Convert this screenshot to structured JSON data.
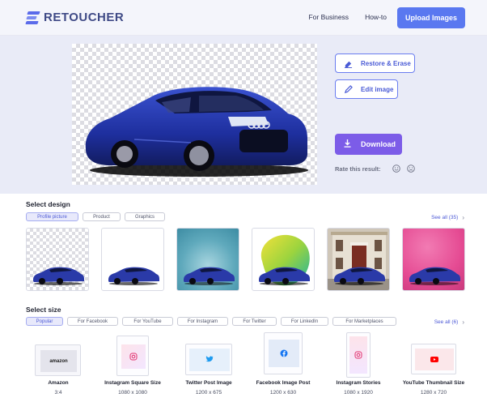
{
  "header": {
    "logo_text": "RETOUCHER",
    "nav": [
      "For Business",
      "How-to"
    ],
    "upload_label": "Upload Images"
  },
  "hero": {
    "restore_label": "Restore & Erase",
    "edit_label": "Edit image",
    "download_label": "Download",
    "rate_label": "Rate this result:"
  },
  "design": {
    "title": "Select design",
    "chips": [
      "Profile picture",
      "Product",
      "Graphics"
    ],
    "see_all": "See all (35)",
    "thumbs": [
      "transparent",
      "white",
      "teal",
      "blob",
      "house",
      "pink"
    ]
  },
  "size": {
    "title": "Select size",
    "chips": [
      "Popular",
      "For Facebook",
      "For YouTube",
      "For Instagram",
      "For Twitter",
      "For LinkedIn",
      "For Marketplaces"
    ],
    "see_all": "See all (6)",
    "items": [
      {
        "name": "Amazon",
        "dims": "3:4",
        "icon": "amazon-logo"
      },
      {
        "name": "Instagram Square Size",
        "dims": "1080 x 1080",
        "icon": "instagram-icon"
      },
      {
        "name": "Twitter Post Image",
        "dims": "1200 x 675",
        "icon": "twitter-icon"
      },
      {
        "name": "Facebook Image Post",
        "dims": "1200 x 630",
        "icon": "facebook-icon"
      },
      {
        "name": "Instagram Stories",
        "dims": "1080 x 1920",
        "icon": "instagram-icon"
      },
      {
        "name": "YouTube Thumbnail Size",
        "dims": "1280 x 720",
        "icon": "youtube-icon"
      }
    ],
    "amazon_text": "amazon"
  },
  "colors": {
    "accent": "#5a78f0",
    "download": "#7c5ce8",
    "car": "#2a3aa8"
  }
}
